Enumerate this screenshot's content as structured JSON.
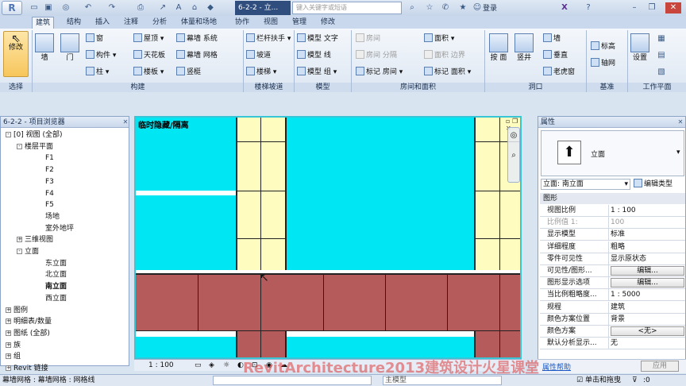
{
  "app": {
    "doc_tab": "6-2-2 - 立...",
    "search_placeholder": "键入关键字或短语",
    "login": "登录"
  },
  "tabs": [
    "建筑",
    "结构",
    "插入",
    "注释",
    "分析",
    "体量和场地",
    "协作",
    "视图",
    "管理",
    "修改"
  ],
  "ribbon": {
    "modify": "修改",
    "wall": "墙",
    "door": "门",
    "window": "窗",
    "component": "构件",
    "column": "柱",
    "roof": "屋顶",
    "ceiling": "天花板",
    "floor": "楼板",
    "curtain_system": "幕墙 系统",
    "curtain_grid": "幕墙 网格",
    "mullion": "竖梃",
    "railing": "栏杆扶手",
    "ramp": "坡道",
    "stair": "楼梯",
    "model_text": "模型 文字",
    "model_line": "模型 线",
    "model_group": "模型 组",
    "room": "房间",
    "room_sep": "房间 分隔",
    "tag_room": "标记 房间",
    "area": "面积",
    "area_boundary": "面积 边界",
    "tag_area": "标记 面积",
    "by_face": "按 面",
    "shaft": "竖井",
    "wall_open": "墙",
    "vertical": "垂直",
    "dormer": "老虎窗",
    "level": "标高",
    "grid": "轴网",
    "set": "设置",
    "panels": {
      "select": "选择",
      "build": "构建",
      "circulation": "楼梯坡道",
      "model": "模型",
      "room_area": "房间和面积",
      "opening": "洞口",
      "datum": "基准",
      "workplane": "工作平面"
    }
  },
  "browser": {
    "title": "6-2-2 - 项目浏览器",
    "items": [
      {
        "label": "[0] 视图 (全部)",
        "level": 0,
        "exp": "-"
      },
      {
        "label": "楼层平面",
        "level": 1,
        "exp": "-"
      },
      {
        "label": "F1",
        "level": 2
      },
      {
        "label": "F2",
        "level": 2
      },
      {
        "label": "F3",
        "level": 2
      },
      {
        "label": "F4",
        "level": 2
      },
      {
        "label": "F5",
        "level": 2
      },
      {
        "label": "场地",
        "level": 2
      },
      {
        "label": "室外地坪",
        "level": 2
      },
      {
        "label": "三维视图",
        "level": 1,
        "exp": "+"
      },
      {
        "label": "立面",
        "level": 1,
        "exp": "-"
      },
      {
        "label": "东立面",
        "level": 2
      },
      {
        "label": "北立面",
        "level": 2
      },
      {
        "label": "南立面",
        "level": 2,
        "bold": true
      },
      {
        "label": "西立面",
        "level": 2
      },
      {
        "label": "图例",
        "level": 0,
        "exp": "+"
      },
      {
        "label": "明细表/数量",
        "level": 0,
        "exp": "+"
      },
      {
        "label": "图纸 (全部)",
        "level": 0,
        "exp": "+"
      },
      {
        "label": "族",
        "level": 0,
        "exp": "+"
      },
      {
        "label": "组",
        "level": 0,
        "exp": "+"
      },
      {
        "label": "Revit 链接",
        "level": 0,
        "exp": "+"
      }
    ]
  },
  "view": {
    "title": "临时隐藏/隔离",
    "scale": "1 : 100"
  },
  "properties": {
    "title": "属性",
    "type_label": "立面",
    "selector": "立面: 南立面",
    "edit_type": "编辑类型",
    "section": "图形",
    "rows": [
      {
        "k": "视图比例",
        "v": "1 : 100"
      },
      {
        "k": "比例值 1:",
        "v": "100",
        "dis": true
      },
      {
        "k": "显示模型",
        "v": "标准"
      },
      {
        "k": "详细程度",
        "v": "粗略"
      },
      {
        "k": "零件可见性",
        "v": "显示原状态"
      },
      {
        "k": "可见性/图形...",
        "v": "编辑...",
        "btn": true
      },
      {
        "k": "图形显示选项",
        "v": "编辑...",
        "btn": true
      },
      {
        "k": "当比例粗略度...",
        "v": "1 : 5000"
      },
      {
        "k": "规程",
        "v": "建筑"
      },
      {
        "k": "颜色方案位置",
        "v": "背景"
      },
      {
        "k": "颜色方案",
        "v": "<无>",
        "btn": true
      },
      {
        "k": "默认分析显示...",
        "v": "无"
      }
    ],
    "help": "属性帮助",
    "apply": "应用"
  },
  "status": {
    "left": "幕墙网格 : 幕墙网格 : 网格线",
    "model": "主模型",
    "press_drag": "单击和拖曳",
    "count": ":0"
  },
  "watermark": "RevitArchitecture2013建筑设计火星课堂"
}
